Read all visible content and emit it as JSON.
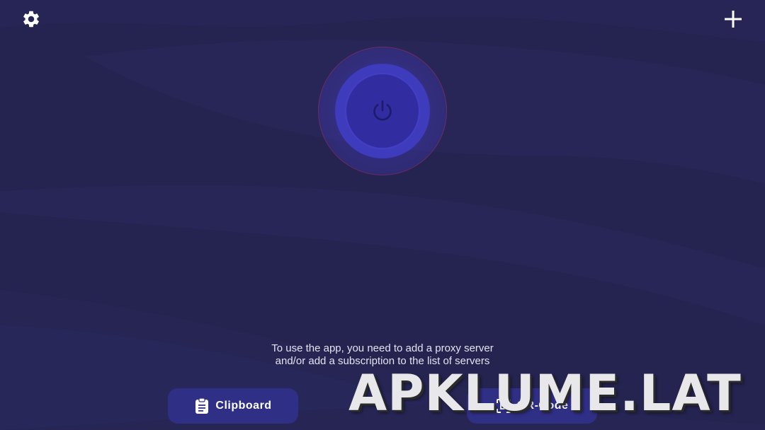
{
  "app": {
    "background_color": "#25234f",
    "accent_color": "#3e3bbd"
  },
  "topbar": {
    "settings_icon": "gear-icon",
    "add_icon": "plus-icon"
  },
  "power": {
    "icon": "power-icon"
  },
  "message": {
    "text": "To use the app, you need to add a proxy server and/or add a subscription to the list of servers"
  },
  "actions": {
    "clipboard": {
      "label": "Clipboard",
      "icon": "clipboard-icon"
    },
    "qr": {
      "label": "QR-Code",
      "icon": "qr-scan-icon"
    }
  },
  "watermark": {
    "text": "APKLUME.LAT"
  }
}
